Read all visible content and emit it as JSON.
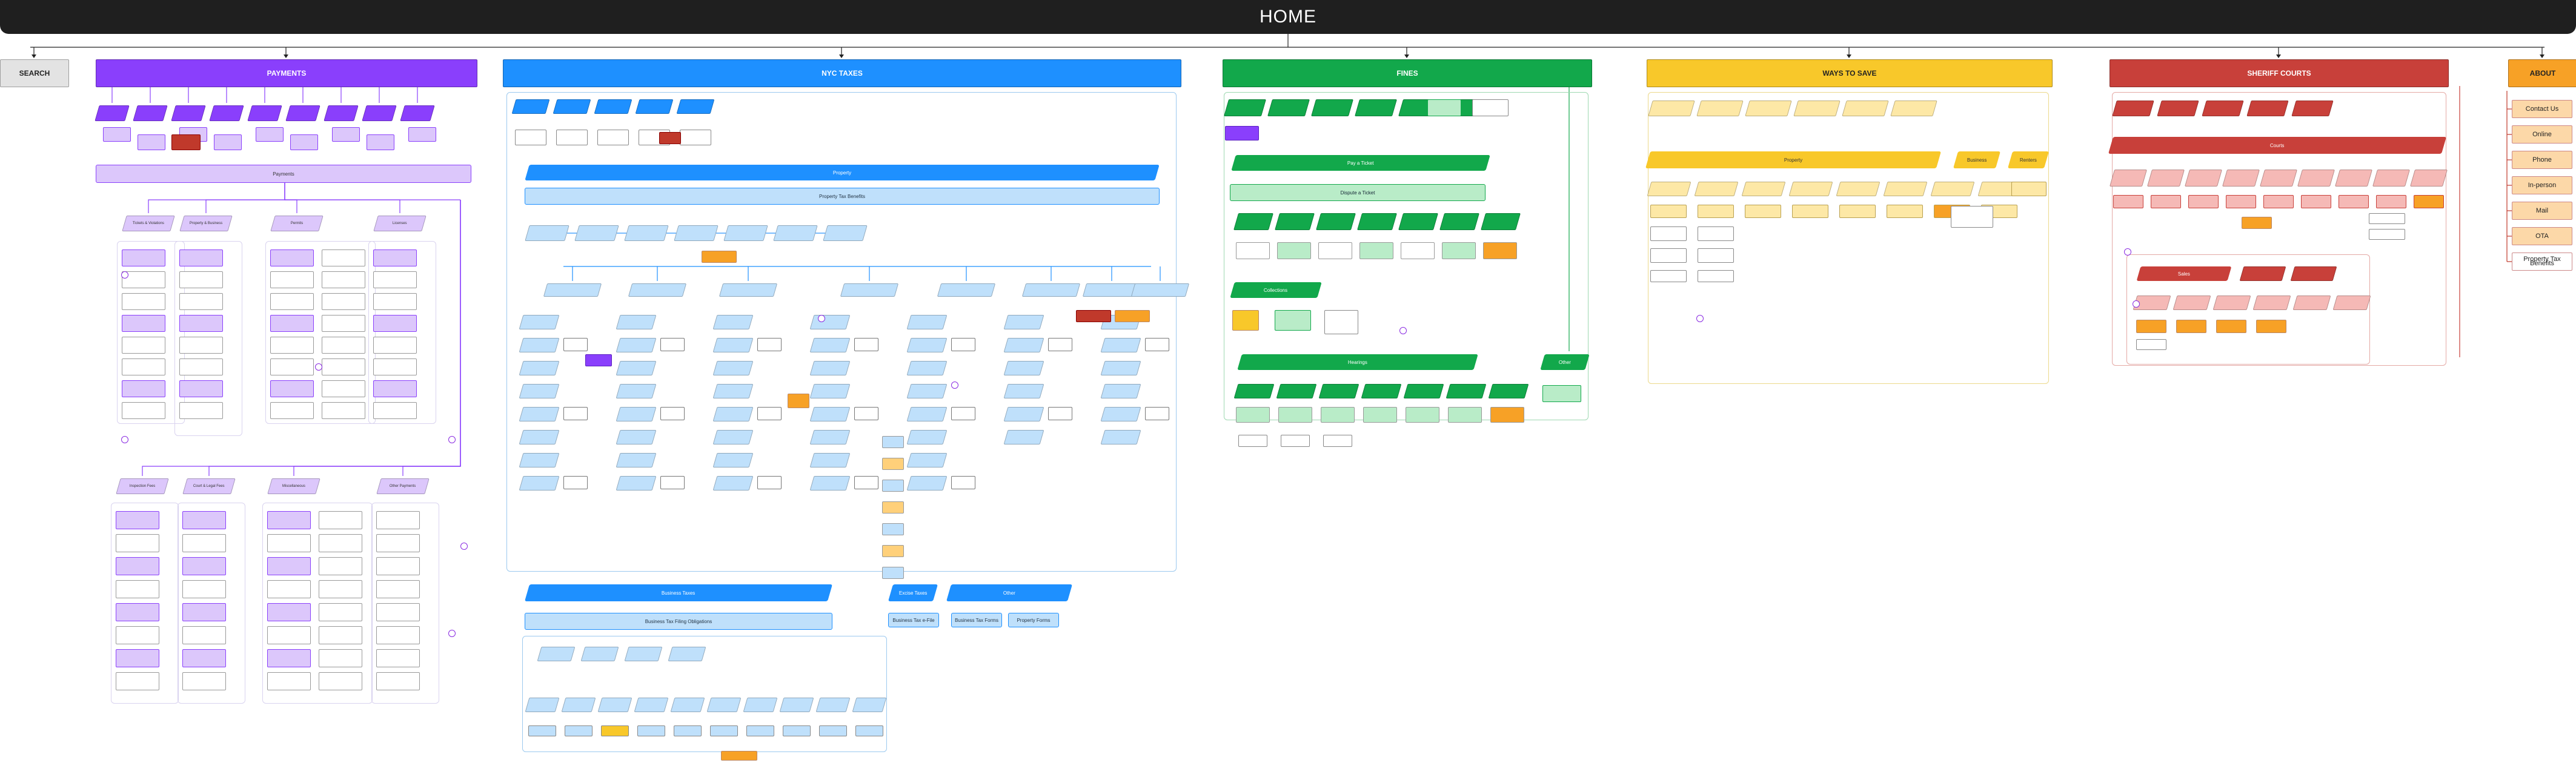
{
  "home": {
    "title": "HOME"
  },
  "colors": {
    "search": "#e3e3e3",
    "payments": "#8a3ffc",
    "payments_light": "#dcc7fb",
    "taxes": "#1e90ff",
    "taxes_light": "#bfe0fb",
    "fines": "#12a84b",
    "fines_light": "#b9ecc8",
    "save": "#f8c82a",
    "save_light": "#fde8a6",
    "sheriff": "#c8403a",
    "sheriff_light": "#f5b9b6",
    "about": "#f7a126",
    "about_light": "#fcd8a8",
    "warn": "#f7a126",
    "danger": "#c0392b"
  },
  "sections": {
    "search": "SEARCH",
    "payments": "PAYMENTS",
    "taxes": "NYC TAXES",
    "fines": "FINES",
    "save": "WAYS TO SAVE",
    "sheriff": "SHERIFF COURTS",
    "about": "ABOUT"
  },
  "about": {
    "items": [
      "Contact Us",
      "Online",
      "Phone",
      "In-person",
      "Mail",
      "OTA",
      "Property Tax Benefits"
    ]
  },
  "payments": {
    "bar": "Payments",
    "groups": [
      "Tickets & Violations",
      "Property & Business",
      "Permits",
      "Licenses",
      "Inspection Fees",
      "Court & Legal Fees",
      "Miscellaneous",
      "Other Payments"
    ]
  },
  "taxes": {
    "bar_property": "Property",
    "sub_property": "Property Tax Benefits",
    "bar_business": "Business Taxes",
    "sub_business": "Business Tax Filing Obligations",
    "bar_excise": "Excise Taxes",
    "bar_other": "Other",
    "sub_excise": "Business Tax e-File",
    "sub_other_a": "Business Tax Forms",
    "sub_other_b": "Property Forms"
  },
  "fines": {
    "bar_main": "Pay a Ticket",
    "sub_main": "Dispute a Ticket",
    "bar_collect": "Collections",
    "bar_hearing": "Hearings",
    "bar_other": "Other"
  },
  "save": {
    "bar_main": "Property",
    "bar_exempt": "Business",
    "bar_other": "Renters"
  },
  "sheriff": {
    "bar_main": "Courts",
    "bar_sub": "Sales"
  }
}
